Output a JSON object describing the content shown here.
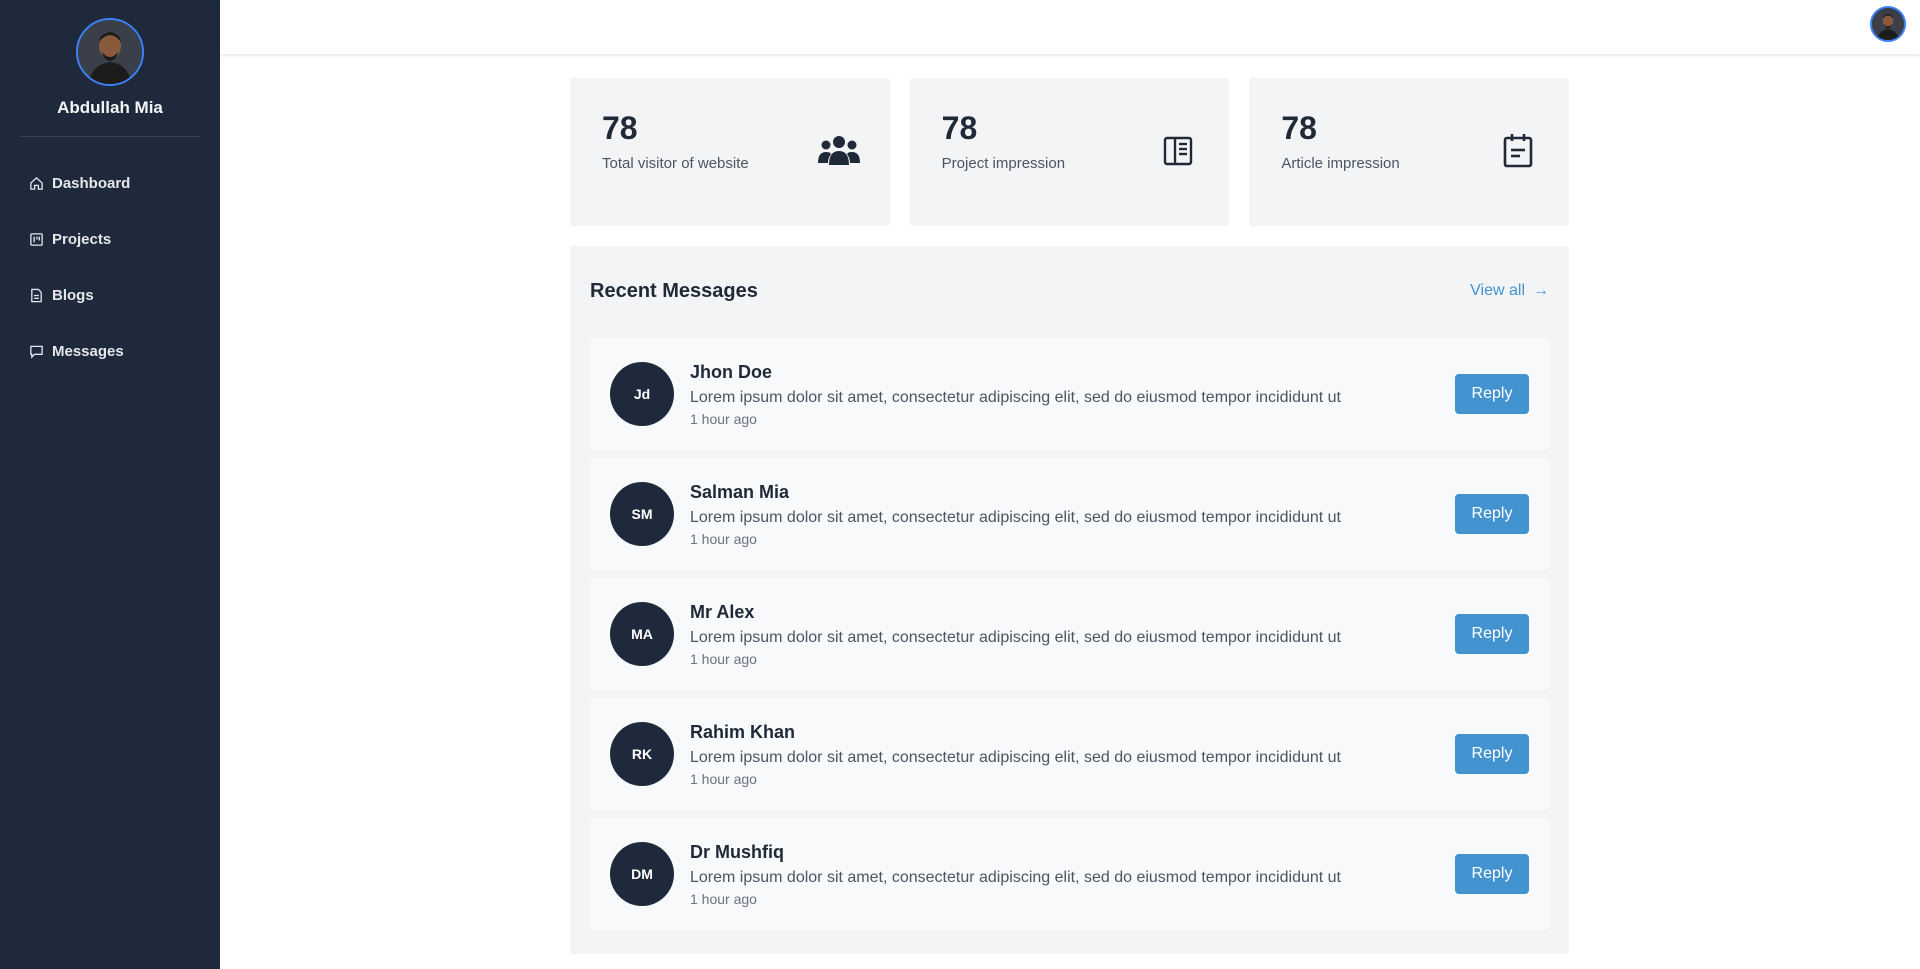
{
  "sidebar": {
    "user": {
      "name": "Abdullah Mia",
      "avatar_icon": "user-photo"
    },
    "items": [
      {
        "label": "Dashboard",
        "icon": "home-icon"
      },
      {
        "label": "Projects",
        "icon": "kanban-icon"
      },
      {
        "label": "Blogs",
        "icon": "document-icon"
      },
      {
        "label": "Messages",
        "icon": "chat-icon"
      }
    ]
  },
  "stats": [
    {
      "value": "78",
      "label": "Total visitor of website",
      "icon": "users-icon"
    },
    {
      "value": "78",
      "label": "Project impression",
      "icon": "layout-panel-icon"
    },
    {
      "value": "78",
      "label": "Article impression",
      "icon": "calendar-note-icon"
    }
  ],
  "messages": {
    "title": "Recent Messages",
    "view_all": "View all",
    "view_all_arrow": "→",
    "items": [
      {
        "initials": "Jd",
        "name": "Jhon Doe",
        "text": "Lorem ipsum dolor sit amet, consectetur adipiscing elit, sed do eiusmod tempor incididunt ut",
        "time": "1 hour ago",
        "action": "Reply"
      },
      {
        "initials": "SM",
        "name": "Salman Mia",
        "text": "Lorem ipsum dolor sit amet, consectetur adipiscing elit, sed do eiusmod tempor incididunt ut",
        "time": "1 hour ago",
        "action": "Reply"
      },
      {
        "initials": "MA",
        "name": "Mr Alex",
        "text": "Lorem ipsum dolor sit amet, consectetur adipiscing elit, sed do eiusmod tempor incididunt ut",
        "time": "1 hour ago",
        "action": "Reply"
      },
      {
        "initials": "RK",
        "name": "Rahim Khan",
        "text": "Lorem ipsum dolor sit amet, consectetur adipiscing elit, sed do eiusmod tempor incididunt ut",
        "time": "1 hour ago",
        "action": "Reply"
      },
      {
        "initials": "DM",
        "name": "Dr Mushfiq",
        "text": "Lorem ipsum dolor sit amet, consectetur adipiscing elit, sed do eiusmod tempor incididunt ut",
        "time": "1 hour ago",
        "action": "Reply"
      }
    ]
  },
  "colors": {
    "sidebar_bg": "#1e293b",
    "accent": "#4393d1",
    "panel_bg": "#f3f4f6",
    "avatar_border": "#3b82f6"
  }
}
